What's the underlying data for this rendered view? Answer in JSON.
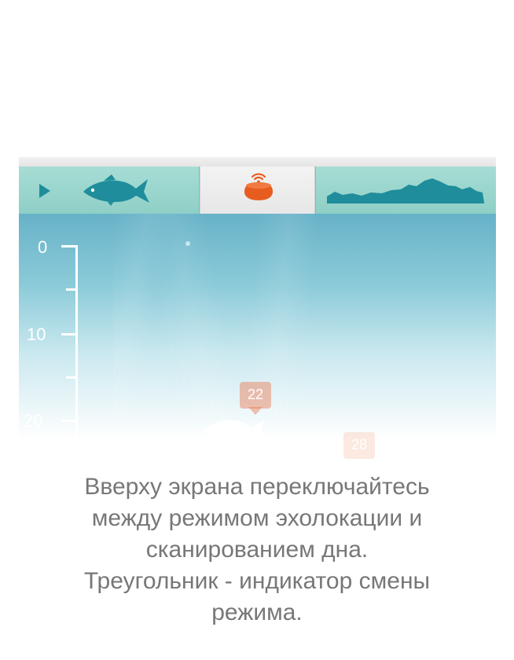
{
  "depth_scale": {
    "labels": [
      "0",
      "10",
      "20"
    ]
  },
  "fish_marks": [
    {
      "depth_label": "22"
    },
    {
      "depth_label": "28"
    }
  ],
  "icons": {
    "play_indicator": "triangle-play-icon",
    "fish_mode": "fish-icon",
    "sonar_device": "sonar-buoy-icon",
    "bottom_scan_mode": "bottom-profile-icon"
  },
  "colors": {
    "tab_active": "#e9e9e9",
    "tab_inactive": "#9ad7ce",
    "accent_teal": "#1f8d9b",
    "accent_orange": "#e85c1f",
    "caption_text": "#777777"
  },
  "caption": {
    "line1": "Вверху экрана переключайтесь",
    "line2": "между режимом эхолокации и",
    "line3": "сканированием дна.",
    "line4": "Треугольник - индикатор смены",
    "line5": "режима."
  }
}
